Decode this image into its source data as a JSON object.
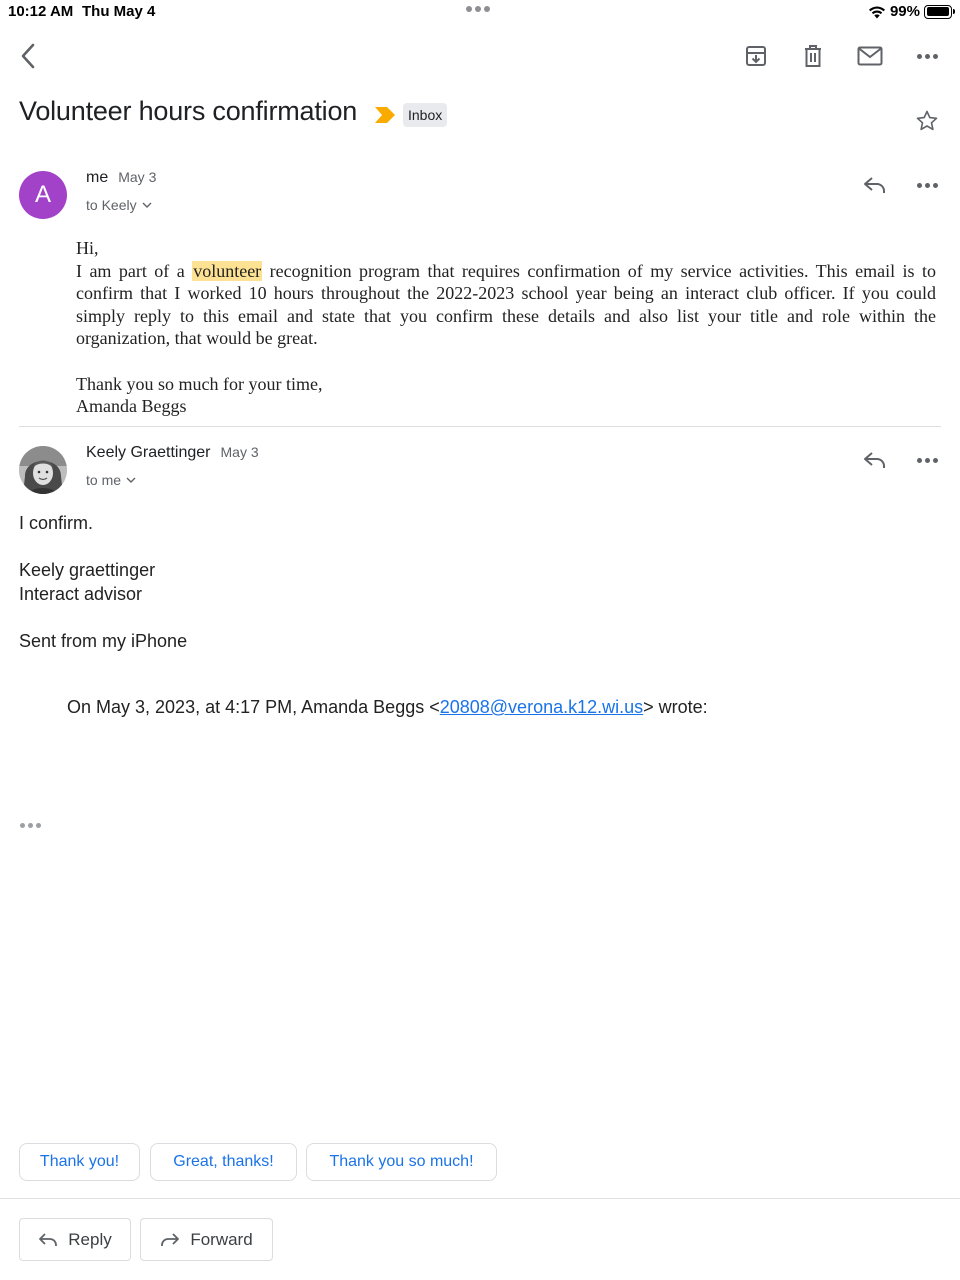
{
  "status_bar": {
    "time": "10:12 AM",
    "date": "Thu May 4",
    "battery": "99%",
    "battery_level": 0.99,
    "icons": [
      "wifi-icon",
      "battery-icon"
    ]
  },
  "toolbar": {
    "icons": [
      "back-icon",
      "archive-icon",
      "delete-icon",
      "mark-unread-icon",
      "more-icon"
    ]
  },
  "subject": {
    "title": "Volunteer hours confirmation",
    "label": "Inbox",
    "importance_color": "#f9ab00"
  },
  "messages": [
    {
      "avatar_letter": "A",
      "avatar_color": "#a142c9",
      "sender": "me",
      "date": "May 3",
      "recipient": "to Keely",
      "body": {
        "greeting": "Hi,",
        "line_pre": "I am part of a ",
        "highlight": "volunteer",
        "line_post": " recognition program that requires confirmation of my service activities. This email is to confirm that I worked 10 hours throughout the 2022-2023 school year being an interact club officer. If you could simply reply to this email and state that you confirm these details and also list your title and role within the organization, that would be great.",
        "closing": "Thank you so much for your time,",
        "signature": "Amanda Beggs"
      }
    },
    {
      "sender": "Keely Graettinger",
      "date": "May 3",
      "recipient": "to me",
      "body": {
        "line1": "I confirm.",
        "sig_name": "Keely graettinger",
        "sig_title": "Interact advisor",
        "sent_from": "Sent from my iPhone",
        "quote_pre": "On May 3, 2023, at 4:17 PM, Amanda Beggs <",
        "quote_email": "20808@verona.k12.wi.us",
        "quote_post": "> wrote:"
      }
    }
  ],
  "smart_replies": [
    "Thank you!",
    "Great, thanks!",
    "Thank you so much!"
  ],
  "actions": {
    "reply": "Reply",
    "forward": "Forward"
  }
}
